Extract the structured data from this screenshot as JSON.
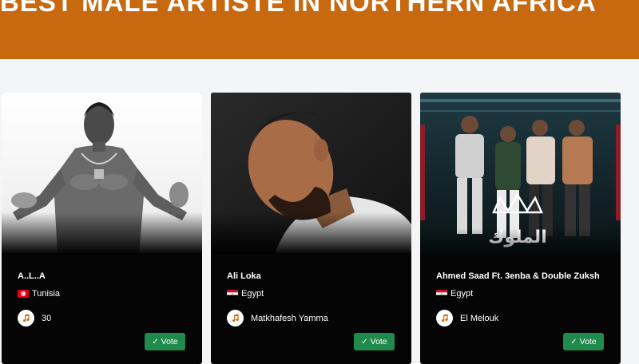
{
  "header": {
    "title": "BEST MALE ARTISTE IN NORTHERN AFRICA",
    "background": "#c8680f"
  },
  "vote_color": "#1f8a4c",
  "nominees": [
    {
      "name": "A..L..A",
      "country": "Tunisia",
      "flag": "tunisia-flag",
      "song": "30",
      "vote_label": "Vote",
      "icon": "music-note-icon"
    },
    {
      "name": "Ali Loka",
      "country": "Egypt",
      "flag": "egypt-flag",
      "song": "Matkhafesh Yamma",
      "vote_label": "Vote",
      "icon": "music-note-icon"
    },
    {
      "name": "Ahmed Saad Ft. 3enba & Double Zuksh",
      "country": "Egypt",
      "flag": "egypt-flag",
      "song": "El Melouk",
      "vote_label": "Vote",
      "icon": "music-note-icon"
    }
  ]
}
